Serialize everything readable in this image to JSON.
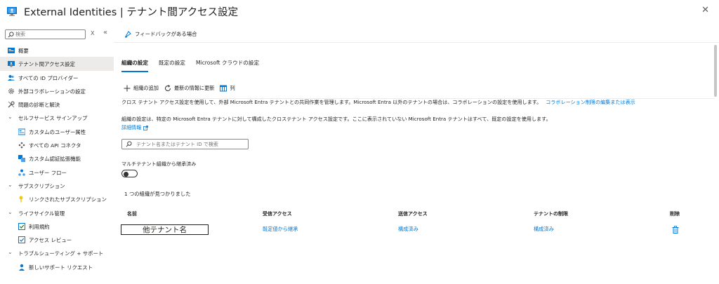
{
  "window": {
    "title": "External Identities | テナント間アクセス設定",
    "more": "···",
    "close": "✕"
  },
  "sidebar": {
    "search_placeholder": "検索",
    "clear": "X",
    "collapse": "«",
    "items": [
      {
        "label": "概要",
        "icon": "overview-icon"
      },
      {
        "label": "テナント間アクセス設定",
        "icon": "cross-tenant-icon",
        "active": true
      },
      {
        "label": "すべての ID プロバイダー",
        "icon": "identity-providers-icon"
      },
      {
        "label": "外部コラボレーションの設定",
        "icon": "gear-icon"
      },
      {
        "label": "問題の診断と解決",
        "icon": "wrench-icon"
      },
      {
        "label": "セルフサービス サインアップ",
        "group": true
      },
      {
        "label": "カスタムのユーザー属性",
        "icon": "attributes-icon",
        "sub": true
      },
      {
        "label": "すべての API コネクタ",
        "icon": "api-connector-icon",
        "sub": true
      },
      {
        "label": "カスタム認証拡張機能",
        "icon": "extension-icon",
        "sub": true
      },
      {
        "label": "ユーザー フロー",
        "icon": "user-flow-icon",
        "sub": true
      },
      {
        "label": "サブスクリプション",
        "group": true
      },
      {
        "label": "リンクされたサブスクリプション",
        "icon": "key-icon",
        "sub": true
      },
      {
        "label": "ライフサイクル管理",
        "group": true
      },
      {
        "label": "利用規約",
        "icon": "terms-icon",
        "sub": true
      },
      {
        "label": "アクセス レビュー",
        "icon": "access-review-icon",
        "sub": true
      },
      {
        "label": "トラブルシューティング + サポート",
        "group": true
      },
      {
        "label": "新しいサポート リクエスト",
        "icon": "support-icon",
        "sub": true
      }
    ]
  },
  "main": {
    "feedback": "フィードバックがある場合",
    "tabs": [
      "組織の設定",
      "既定の設定",
      "Microsoft クラウドの設定"
    ],
    "toolbar": {
      "add": "組織の追加",
      "refresh": "最新の情報に更新",
      "columns": "列"
    },
    "desc1": "クロス テナント アクセス設定を使用して、外部 Microsoft Entra テナントとの共同作業を管理します。Microsoft Entra 以外のテナントの場合は、コラボレーションの設定を使用します。",
    "desc1_link": "コラボレーション制限の編集または表示",
    "desc2": "組織の設定は、特定の Microsoft Entra テナントに対して構成したクロステナント アクセス設定です。ここに表示されていない Microsoft Entra テナントはすべて、既定の設定を使用します。",
    "more_info": "詳細情報",
    "tenant_search_placeholder": "テナント名またはテナント ID で検索",
    "toggle_label": "マルチテナント組織から継承済み",
    "toggle_on": false,
    "found": "1 つの組織が見つかりました",
    "table": {
      "headers": [
        "名前",
        "受信アクセス",
        "送信アクセス",
        "テナントの制限",
        "削除"
      ],
      "rows": [
        {
          "name": "他テナント名",
          "inbound": "既定値から継承",
          "outbound": "構成済み",
          "restrictions": "構成済み"
        }
      ]
    }
  },
  "colors": {
    "accent": "#0078d4",
    "active_bg": "#edebe9"
  }
}
